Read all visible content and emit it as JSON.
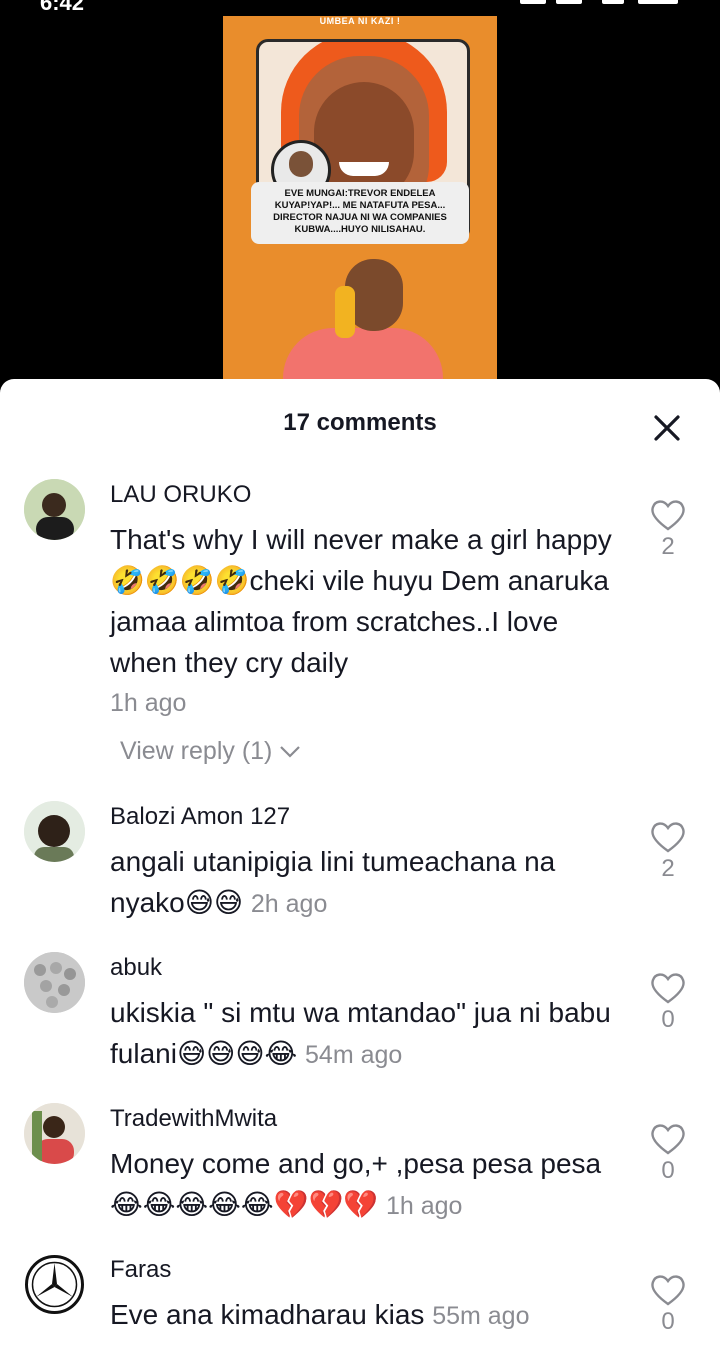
{
  "status_bar": {
    "time": "6:42"
  },
  "video": {
    "tagline": "UMBEA NI KAZI !",
    "caption": "EVE MUNGAI:TREVOR ENDELEA KUYAP!YAP!... ME NATAFUTA PESA... DIRECTOR NAJUA NI WA COMPANIES KUBWA....HUYO NILISAHAU."
  },
  "sheet": {
    "title": "17 comments"
  },
  "comments": [
    {
      "user": "LAU  ORUKO",
      "text": "That's why I will never make a girl happy 🤣🤣🤣🤣cheki vile huyu Dem anaruka jamaa alimtoa from scratches..I love when they cry daily",
      "time": "1h ago",
      "likes": "2",
      "view_reply": "View reply (1)"
    },
    {
      "user": "Balozi Amon 127",
      "text": "angali utanipigia lini tumeachana na nyako😅😅",
      "time": "2h ago",
      "likes": "2"
    },
    {
      "user": "abuk",
      "text": "ukiskia \" si mtu wa mtandao\" jua ni babu fulani😅😅😅😂",
      "time": "54m ago",
      "likes": "0"
    },
    {
      "user": "TradewithMwita",
      "text": "Money come and go,+ ,pesa pesa pesa😂😂😂😂😂💔💔💔",
      "time": "1h ago",
      "likes": "0"
    },
    {
      "user": "Faras",
      "text": "Eve ana kimadharau kias",
      "time": "55m ago",
      "likes": "0"
    }
  ],
  "colors": {
    "accent_orange": "#e98d2c",
    "text": "#161823",
    "muted": "#8a8b91"
  }
}
